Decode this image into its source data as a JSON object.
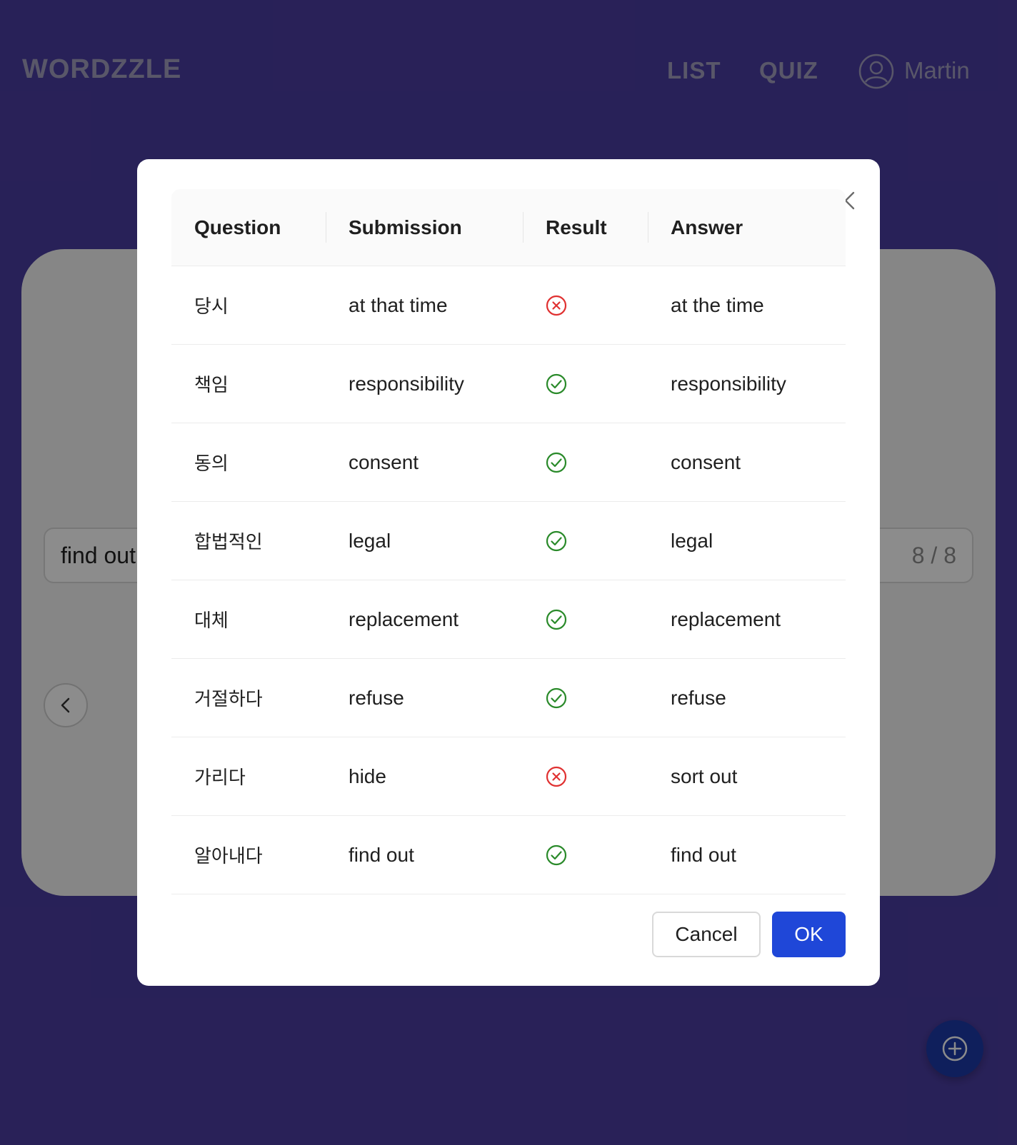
{
  "header": {
    "logo": "WORDZZLE",
    "nav": [
      {
        "label": "LIST"
      },
      {
        "label": "QUIZ"
      }
    ],
    "user_name": "Martin"
  },
  "quiz": {
    "input_value": "find out",
    "count": "8 / 8"
  },
  "modal": {
    "columns": [
      "Question",
      "Submission",
      "Result",
      "Answer"
    ],
    "rows": [
      {
        "question": "당시",
        "submission": "at that time",
        "result": "incorrect",
        "answer": "at the time"
      },
      {
        "question": "책임",
        "submission": "responsibility",
        "result": "correct",
        "answer": "responsibility"
      },
      {
        "question": "동의",
        "submission": "consent",
        "result": "correct",
        "answer": "consent"
      },
      {
        "question": "합법적인",
        "submission": "legal",
        "result": "correct",
        "answer": "legal"
      },
      {
        "question": "대체",
        "submission": "replacement",
        "result": "correct",
        "answer": "replacement"
      },
      {
        "question": "거절하다",
        "submission": "refuse",
        "result": "correct",
        "answer": "refuse"
      },
      {
        "question": "가리다",
        "submission": "hide",
        "result": "incorrect",
        "answer": "sort out"
      },
      {
        "question": "알아내다",
        "submission": "find out",
        "result": "correct",
        "answer": "find out"
      }
    ],
    "cancel_label": "Cancel",
    "ok_label": "OK"
  },
  "colors": {
    "background": "#4a3da1",
    "correct": "#2a8a2a",
    "incorrect": "#e03131",
    "primary": "#1f47d8"
  }
}
